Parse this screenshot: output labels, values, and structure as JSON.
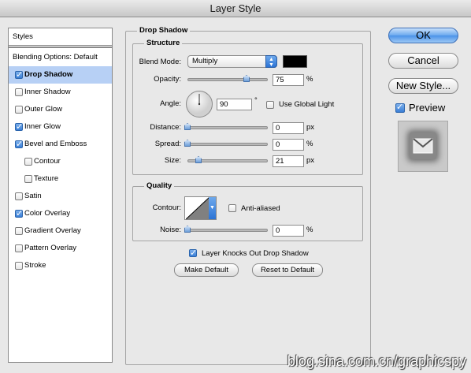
{
  "window": {
    "title": "Layer Style"
  },
  "styles_list": {
    "header": "Styles",
    "blending_options": "Blending Options: Default",
    "items": [
      {
        "label": "Drop Shadow",
        "checked": true,
        "selected": true
      },
      {
        "label": "Inner Shadow",
        "checked": false
      },
      {
        "label": "Outer Glow",
        "checked": false
      },
      {
        "label": "Inner Glow",
        "checked": true
      },
      {
        "label": "Bevel and Emboss",
        "checked": true
      },
      {
        "label": "Contour",
        "checked": false,
        "indent": true
      },
      {
        "label": "Texture",
        "checked": false,
        "indent": true
      },
      {
        "label": "Satin",
        "checked": false
      },
      {
        "label": "Color Overlay",
        "checked": true
      },
      {
        "label": "Gradient Overlay",
        "checked": false
      },
      {
        "label": "Pattern Overlay",
        "checked": false
      },
      {
        "label": "Stroke",
        "checked": false
      }
    ]
  },
  "drop_shadow": {
    "title": "Drop Shadow",
    "structure": {
      "title": "Structure",
      "blend_mode_label": "Blend Mode:",
      "blend_mode_value": "Multiply",
      "shadow_color": "#000000",
      "opacity_label": "Opacity:",
      "opacity_value": "75",
      "opacity_unit": "%",
      "opacity_level": 0.75,
      "angle_label": "Angle:",
      "angle_value": "90",
      "angle_unit": "°",
      "use_global_light_label": "Use Global Light",
      "use_global_light": false,
      "distance_label": "Distance:",
      "distance_value": "0",
      "distance_unit": "px",
      "spread_label": "Spread:",
      "spread_value": "0",
      "spread_unit": "%",
      "size_label": "Size:",
      "size_value": "21",
      "size_unit": "px"
    },
    "quality": {
      "title": "Quality",
      "contour_label": "Contour:",
      "anti_aliased_label": "Anti-aliased",
      "anti_aliased": false,
      "noise_label": "Noise:",
      "noise_value": "0",
      "noise_unit": "%"
    },
    "layer_knocks_out_label": "Layer Knocks Out Drop Shadow",
    "layer_knocks_out": true,
    "make_default_label": "Make Default",
    "reset_to_default_label": "Reset to Default"
  },
  "buttons": {
    "ok": "OK",
    "cancel": "Cancel",
    "new_style": "New Style...",
    "preview_label": "Preview",
    "preview_checked": true
  },
  "watermark": "blog.sina.com.cn/graphicspy"
}
